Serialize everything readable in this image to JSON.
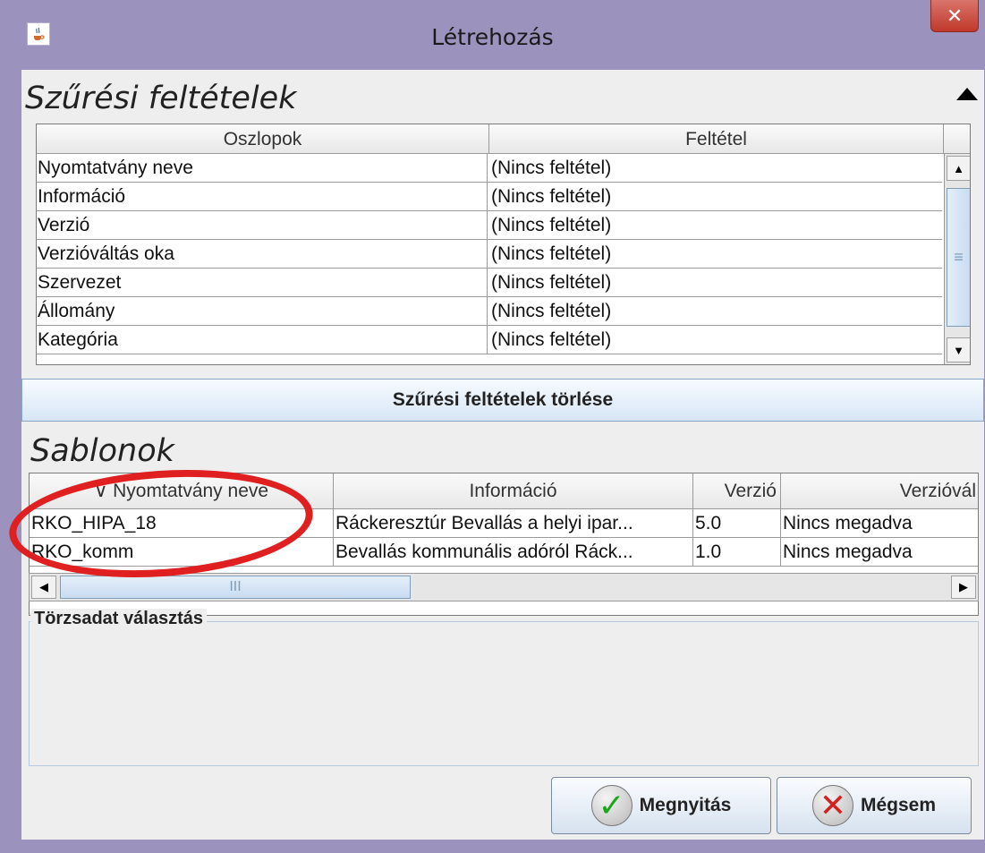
{
  "window": {
    "title": "Létrehozás",
    "close_glyph": "✕",
    "app_icon": "java-coffee-icon"
  },
  "filter_section": {
    "title": "Szűrési feltételek",
    "columns": [
      "Oszlopok",
      "Feltétel"
    ],
    "rows": [
      {
        "column": "Nyomtatvány neve",
        "condition": "(Nincs feltétel)"
      },
      {
        "column": "Információ",
        "condition": "(Nincs feltétel)"
      },
      {
        "column": "Verzió",
        "condition": "(Nincs feltétel)"
      },
      {
        "column": "Verzióváltás oka",
        "condition": "(Nincs feltétel)"
      },
      {
        "column": "Szervezet",
        "condition": "(Nincs feltétel)"
      },
      {
        "column": "Állomány",
        "condition": "(Nincs feltétel)"
      },
      {
        "column": "Kategória",
        "condition": "(Nincs feltétel)"
      }
    ],
    "clear_button": "Szűrési feltételek törlése"
  },
  "templates_section": {
    "title": "Sablonok",
    "columns": [
      "∨ Nyomtatvány neve",
      "Információ",
      "Verzió",
      "Verzióvál"
    ],
    "rows": [
      {
        "name": "RKO_HIPA_18",
        "info": "Ráckeresztúr Bevallás a helyi ipar...",
        "version": "5.0",
        "reason": "Nincs megadva"
      },
      {
        "name": "RKO_komm",
        "info": "Bevallás kommunális adóról Ráck...",
        "version": "1.0",
        "reason": "Nincs megadva"
      }
    ],
    "scroll_thumb_grip": "III"
  },
  "master_data": {
    "title": "Törzsadat választás"
  },
  "buttons": {
    "open": "Megnyitás",
    "cancel": "Mégsem"
  },
  "colors": {
    "title_bar": "#9b93bd",
    "close_button": "#c0392b",
    "annotation": "#e02020"
  }
}
